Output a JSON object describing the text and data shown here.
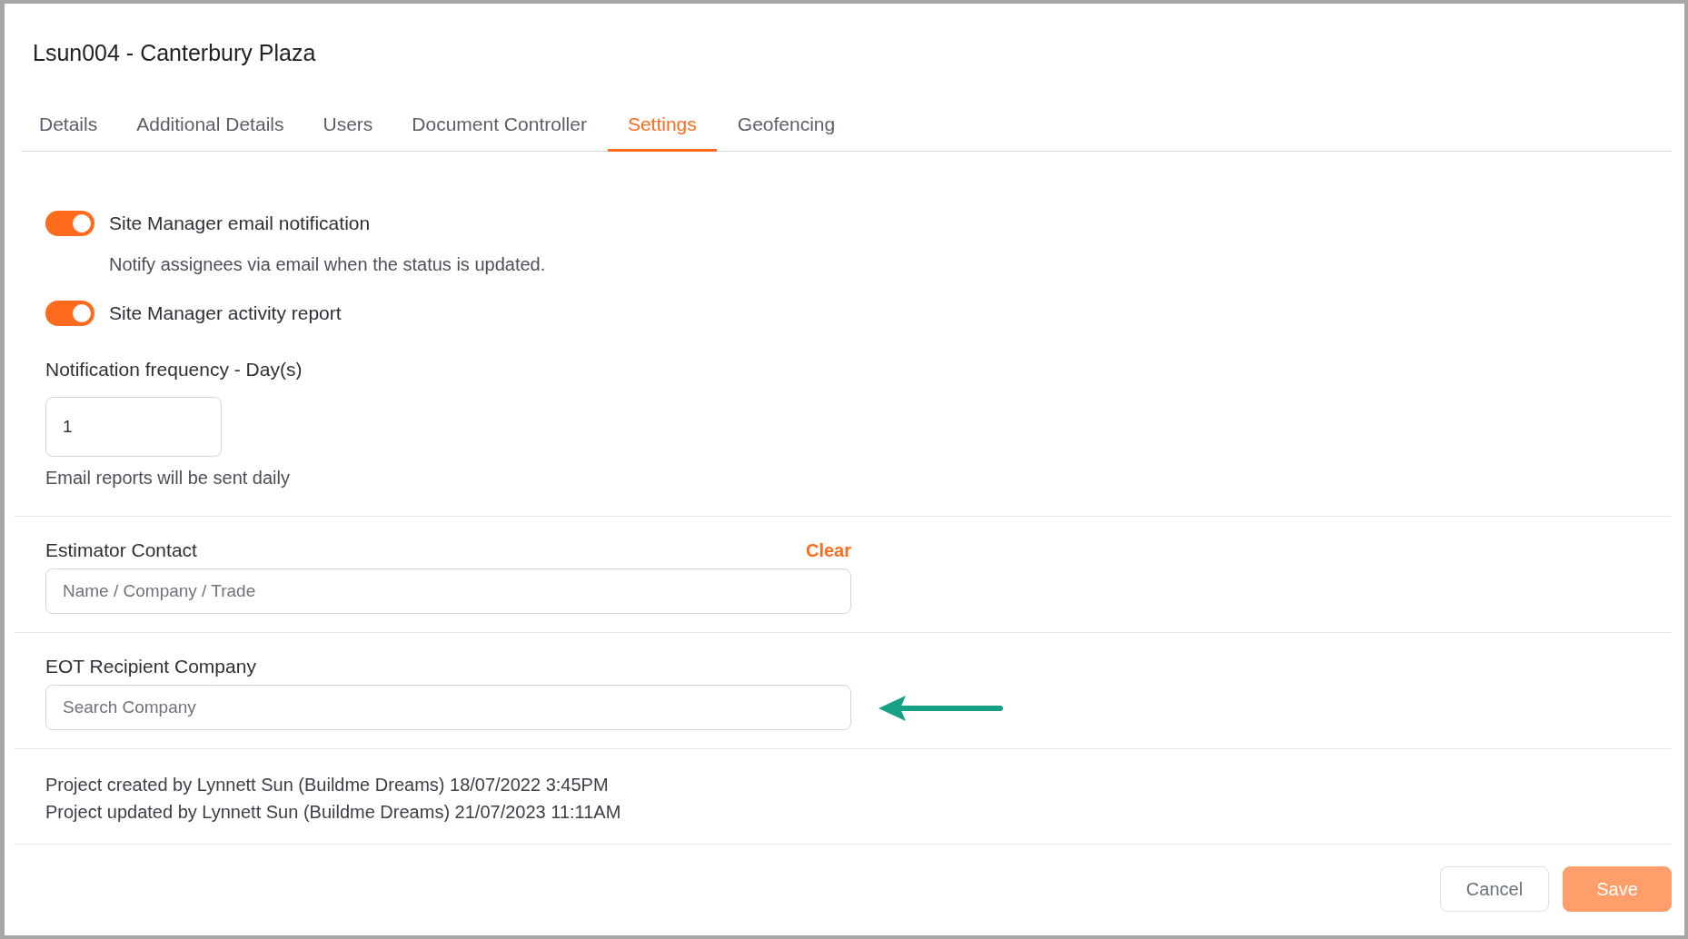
{
  "window": {
    "title": "Lsun004 - Canterbury Plaza"
  },
  "tabs": [
    {
      "label": "Details",
      "selected": false
    },
    {
      "label": "Additional Details",
      "selected": false
    },
    {
      "label": "Users",
      "selected": false
    },
    {
      "label": "Document Controller",
      "selected": false
    },
    {
      "label": "Settings",
      "selected": true
    },
    {
      "label": "Geofencing",
      "selected": false
    }
  ],
  "notifications": [
    {
      "label": "Site Manager email notification",
      "on": true,
      "description": "Notify assignees via email when the status is updated."
    },
    {
      "label": "Site Manager activity report",
      "on": true
    }
  ],
  "frequency": {
    "label": "Notification frequency - Day(s)",
    "value": "1",
    "hint": "Email reports will be sent daily"
  },
  "estimator_contact": {
    "label": "Estimator Contact",
    "clear_link": "Clear",
    "placeholder": "Name / Company / Trade"
  },
  "eot_recipient": {
    "label": "EOT Recipient Company",
    "placeholder": "Search Company"
  },
  "audit": [
    "Project created by Lynnett Sun (Buildme Dreams) 18/07/2022 3:45PM",
    "Project updated by Lynnett Sun (Buildme Dreams) 21/07/2023 11:11AM"
  ],
  "buttons": [
    {
      "label": "Cancel",
      "kind": "secondary",
      "disabled": false
    },
    {
      "label": "Save",
      "kind": "primary",
      "disabled": true
    }
  ]
}
